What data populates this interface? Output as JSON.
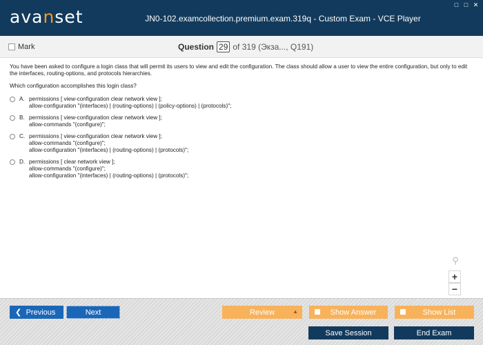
{
  "window": {
    "logo_prefix": "ava",
    "logo_accent": "n",
    "logo_suffix": "set",
    "title": "JN0-102.examcollection.premium.exam.319q - Custom Exam - VCE Player",
    "controls": [
      "□",
      "□",
      "✕"
    ]
  },
  "question_bar": {
    "mark_label": "Mark",
    "question_word": "Question",
    "question_number": "29",
    "question_rest": "of 319 (Экза..., Q191)"
  },
  "question": {
    "stem": "You have been asked to configure a login class that will permit its users to view and edit the configuration. The class should allow a user to view the entire configuration, but only to edit the interfaces, routing-options, and protocols hierarchies.",
    "prompt": "Which configuration accomplishes this login class?",
    "options": [
      {
        "letter": "A.",
        "lines": [
          "permissions [ view-configuration clear network view ];",
          "allow-configuration \"(interfaces) | (routing-options) | (policy-options) | (protocols)\";"
        ]
      },
      {
        "letter": "B.",
        "lines": [
          "permissions [ view-configuration clear network view ];",
          "allow-commands \"(configure)\";"
        ]
      },
      {
        "letter": "C.",
        "lines": [
          "permissions [ view-configuration clear network view ];",
          "allow-commands \"(configure)\";",
          "allow-configuration \"(interfaces) | (routing-options) | (protocols)\";"
        ]
      },
      {
        "letter": "D.",
        "lines": [
          "permissions [ clear network view ];",
          "allow-commands \"(configure)\";",
          "allow-configuration \"(interfaces) | (routing-options) | (protocols)\";"
        ]
      }
    ]
  },
  "zoom": {
    "search_icon": "magnifier-icon",
    "zoom_in": "+",
    "zoom_out": "−"
  },
  "buttons": {
    "previous": "Previous",
    "next": "Next",
    "review": "Review",
    "show_answer": "Show Answer",
    "show_list": "Show List",
    "save_session": "Save Session",
    "end_exam": "End Exam"
  },
  "colors": {
    "header": "#123a5c",
    "accent": "#f39a1e",
    "nav_button": "#1a67b8",
    "orange_button": "#f8b25a"
  }
}
